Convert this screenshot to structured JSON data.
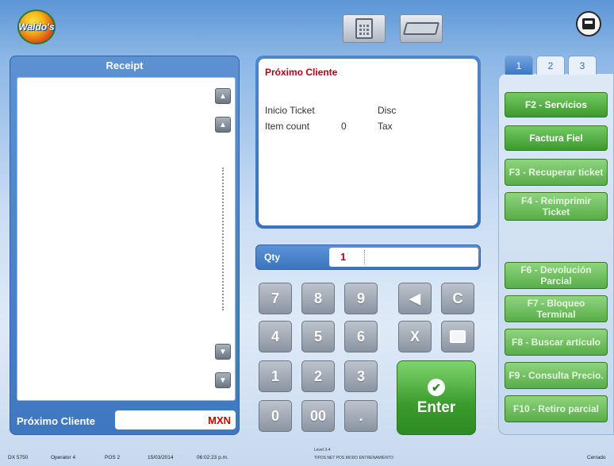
{
  "header": {
    "logo_text": "Waldo's",
    "buttons": [
      "calculator-icon",
      "keyboard-icon",
      "printer-icon"
    ]
  },
  "receipt": {
    "title": "Receipt",
    "customer_label": "Próximo Cliente",
    "currency": "MXN"
  },
  "ticket": {
    "title": "Próximo Cliente",
    "inicio_label": "Inicio Ticket",
    "disc_label": "Disc",
    "item_count_label": "Item count",
    "item_count_value": "0",
    "tax_label": "Tax"
  },
  "qty": {
    "label": "Qty",
    "value": "1"
  },
  "keypad": {
    "keys_row1": [
      "7",
      "8",
      "9"
    ],
    "keys_row2": [
      "4",
      "5",
      "6"
    ],
    "keys_row3": [
      "1",
      "2",
      "3"
    ],
    "keys_row4": [
      "0",
      "00",
      "."
    ],
    "clear": "C",
    "cancel": "X",
    "enter": "Enter"
  },
  "tabs": [
    "1",
    "2",
    "3"
  ],
  "function_buttons": [
    "F2 - Servicios",
    "Factura Fiel",
    "F3 - Recuperar ticket",
    "F4 - Reimprimir Ticket",
    "F6 - Devolución Parcial",
    "F7 - Bloqueo Terminal",
    "F8 - Buscar artículo",
    "F9 - Consulta Precio.",
    "F10 - Retiro parcial"
  ],
  "status": {
    "store": "DX 5750",
    "operator": "Operator 4",
    "pos": "POS 2",
    "date": "15/03/2014",
    "time": "06:02:23 p.m.",
    "line1": "Level 3-4",
    "line2": "TIPOS NET POS MODO ENTRENAMIENTO",
    "right": "Cerrado"
  }
}
